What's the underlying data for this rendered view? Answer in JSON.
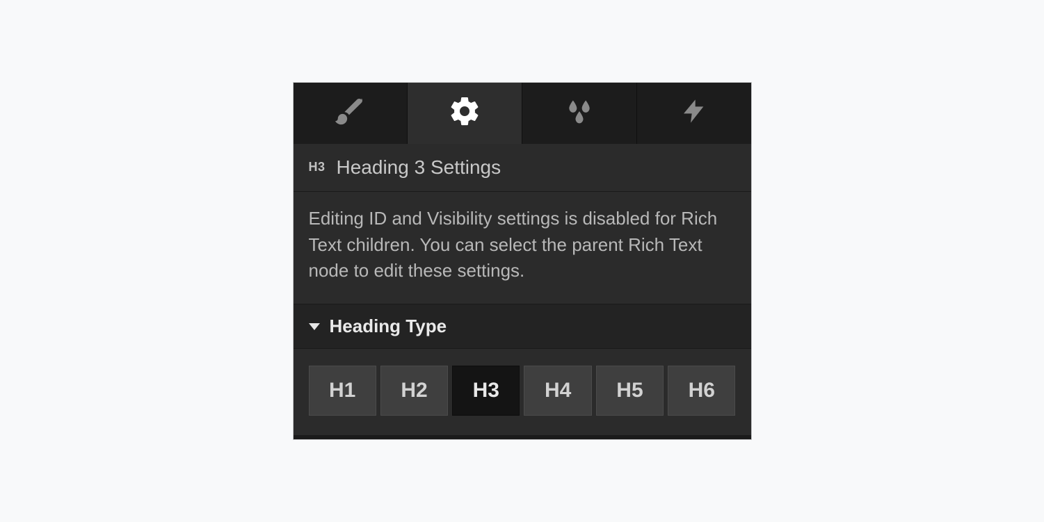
{
  "tabs": [
    {
      "id": "style",
      "icon": "brush-icon",
      "active": false
    },
    {
      "id": "settings",
      "icon": "gear-icon",
      "active": true
    },
    {
      "id": "effects",
      "icon": "droplets-icon",
      "active": false
    },
    {
      "id": "interact",
      "icon": "bolt-icon",
      "active": false
    }
  ],
  "title": {
    "badge": "H3",
    "text": "Heading 3 Settings"
  },
  "description": "Editing ID and Visibility settings is disabled for Rich Text children. You can select the parent Rich Text node to edit these settings.",
  "section": {
    "label": "Heading Type",
    "expanded": true
  },
  "heading_types": [
    {
      "label": "H1",
      "selected": false
    },
    {
      "label": "H2",
      "selected": false
    },
    {
      "label": "H3",
      "selected": true
    },
    {
      "label": "H4",
      "selected": false
    },
    {
      "label": "H5",
      "selected": false
    },
    {
      "label": "H6",
      "selected": false
    }
  ],
  "colors": {
    "panel_bg": "#2b2b2b",
    "tab_bg": "#1c1c1c",
    "tab_active_bg": "#2e2e2e",
    "text": "#c9c9c9",
    "btn_bg": "#3f3f3f",
    "btn_selected_bg": "#141414"
  }
}
